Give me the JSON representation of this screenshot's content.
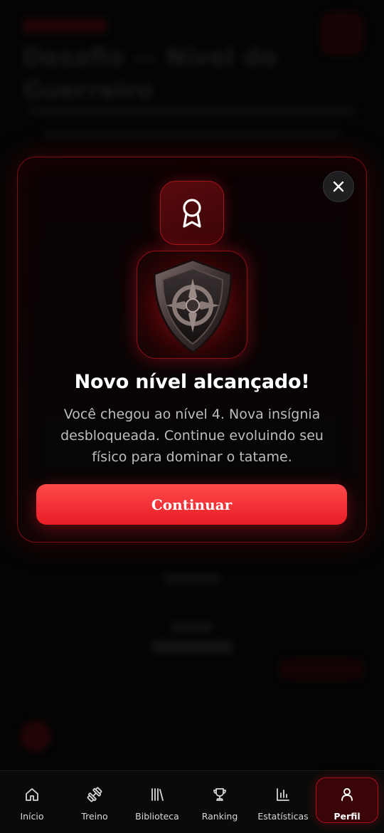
{
  "background": {
    "title": "Desafio — Nível do Guerreiro"
  },
  "modal": {
    "title": "Novo nível alcançado!",
    "body": "Você chegou ao nível 4. Nova insígnia desbloqueada. Continue evoluindo seu físico para dominar o tatame.",
    "continue_label": "Continuar",
    "close_icon": "close-icon",
    "award_icon": "award-ribbon-icon",
    "badge_image": "shield-badge"
  },
  "nav": {
    "items": [
      {
        "label": "Início",
        "icon": "home-icon"
      },
      {
        "label": "Treino",
        "icon": "dumbbell-icon"
      },
      {
        "label": "Biblioteca",
        "icon": "library-icon"
      },
      {
        "label": "Ranking",
        "icon": "trophy-icon"
      },
      {
        "label": "Estatísticas",
        "icon": "bar-chart-icon"
      },
      {
        "label": "Perfil",
        "icon": "user-icon"
      }
    ],
    "active": "Perfil"
  },
  "colors": {
    "accent": "#ff3b3b",
    "accent_dark": "#3a0508",
    "border_red": "#a3151c",
    "background": "#040404",
    "body_text": "#bdbdbd"
  }
}
